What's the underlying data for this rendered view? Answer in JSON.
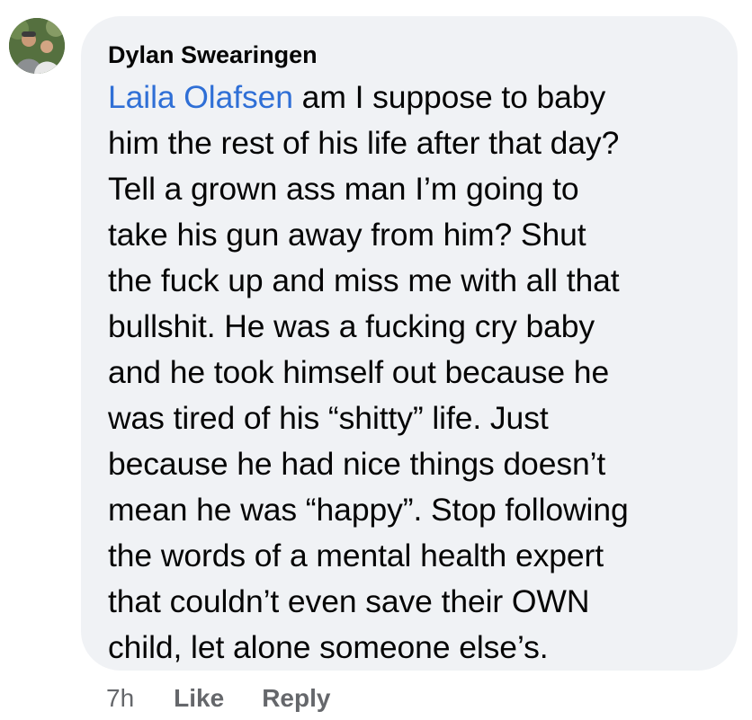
{
  "comment": {
    "author": "Dylan Swearingen",
    "mention": "Laila Olafsen",
    "lines": [
      " am I suppose to baby",
      "him the rest of his life after that day?",
      "Tell a grown ass man I’m going to",
      "take his gun away from him? Shut",
      "the fuck up and miss me with all that",
      "bullshit. He was a fucking cry baby",
      "and he took himself out because he",
      "was tired of his “shitty” life. Just",
      "because he had nice things doesn’t",
      "mean he was “happy”. Stop following",
      "the words of a mental health expert",
      "that couldn’t even save their OWN",
      "child, let alone someone else’s."
    ],
    "timestamp": "7h",
    "actions": {
      "like_label": "Like",
      "reply_label": "Reply"
    }
  },
  "colors": {
    "bubble_background": "#f0f2f5",
    "mention": "#2f6fd6",
    "meta_text": "#65676b",
    "body_text": "#050505"
  },
  "icons": {
    "avatar": "profile-photo"
  }
}
